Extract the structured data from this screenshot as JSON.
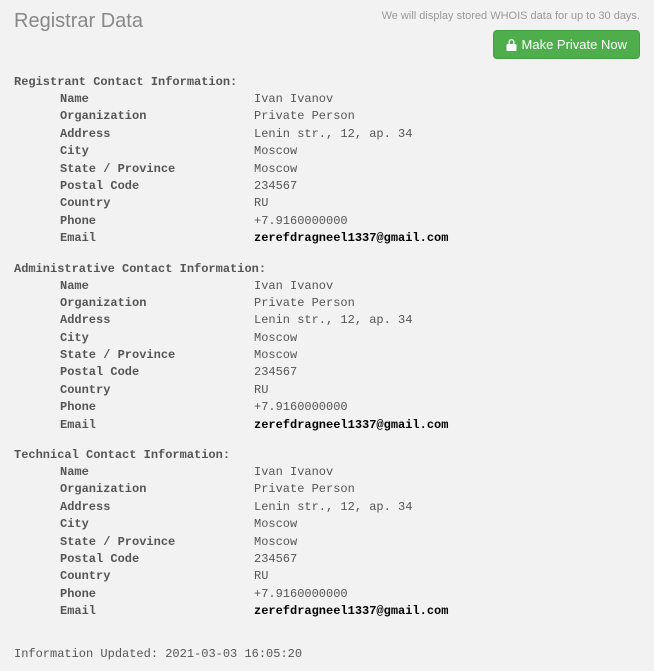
{
  "header": {
    "title": "Registrar Data",
    "disclaimer": "We will display stored WHOIS data for up to 30 days.",
    "button_label": "Make Private Now"
  },
  "sections": [
    {
      "title": "Registrant Contact Information:",
      "fields": [
        {
          "label": "Name",
          "value": "Ivan Ivanov"
        },
        {
          "label": "Organization",
          "value": "Private Person"
        },
        {
          "label": "Address",
          "value": "Lenin str., 12, ap. 34"
        },
        {
          "label": "City",
          "value": "Moscow"
        },
        {
          "label": "State / Province",
          "value": "Moscow"
        },
        {
          "label": "Postal Code",
          "value": "234567"
        },
        {
          "label": "Country",
          "value": "RU"
        },
        {
          "label": "Phone",
          "value": "+7.9160000000"
        },
        {
          "label": "Email",
          "value": "zerefdragneel1337@gmail.com",
          "email": true
        }
      ]
    },
    {
      "title": "Administrative Contact Information:",
      "fields": [
        {
          "label": "Name",
          "value": "Ivan Ivanov"
        },
        {
          "label": "Organization",
          "value": "Private Person"
        },
        {
          "label": "Address",
          "value": "Lenin str., 12, ap. 34"
        },
        {
          "label": "City",
          "value": "Moscow"
        },
        {
          "label": "State / Province",
          "value": "Moscow"
        },
        {
          "label": "Postal Code",
          "value": "234567"
        },
        {
          "label": "Country",
          "value": "RU"
        },
        {
          "label": "Phone",
          "value": "+7.9160000000"
        },
        {
          "label": "Email",
          "value": "zerefdragneel1337@gmail.com",
          "email": true
        }
      ]
    },
    {
      "title": "Technical Contact Information:",
      "fields": [
        {
          "label": "Name",
          "value": "Ivan Ivanov"
        },
        {
          "label": "Organization",
          "value": "Private Person"
        },
        {
          "label": "Address",
          "value": "Lenin str., 12, ap. 34"
        },
        {
          "label": "City",
          "value": "Moscow"
        },
        {
          "label": "State / Province",
          "value": "Moscow"
        },
        {
          "label": "Postal Code",
          "value": "234567"
        },
        {
          "label": "Country",
          "value": "RU"
        },
        {
          "label": "Phone",
          "value": "+7.9160000000"
        },
        {
          "label": "Email",
          "value": "zerefdragneel1337@gmail.com",
          "email": true
        }
      ]
    }
  ],
  "updated_label": "Information Updated:",
  "updated_value": "2021-03-03 16:05:20"
}
